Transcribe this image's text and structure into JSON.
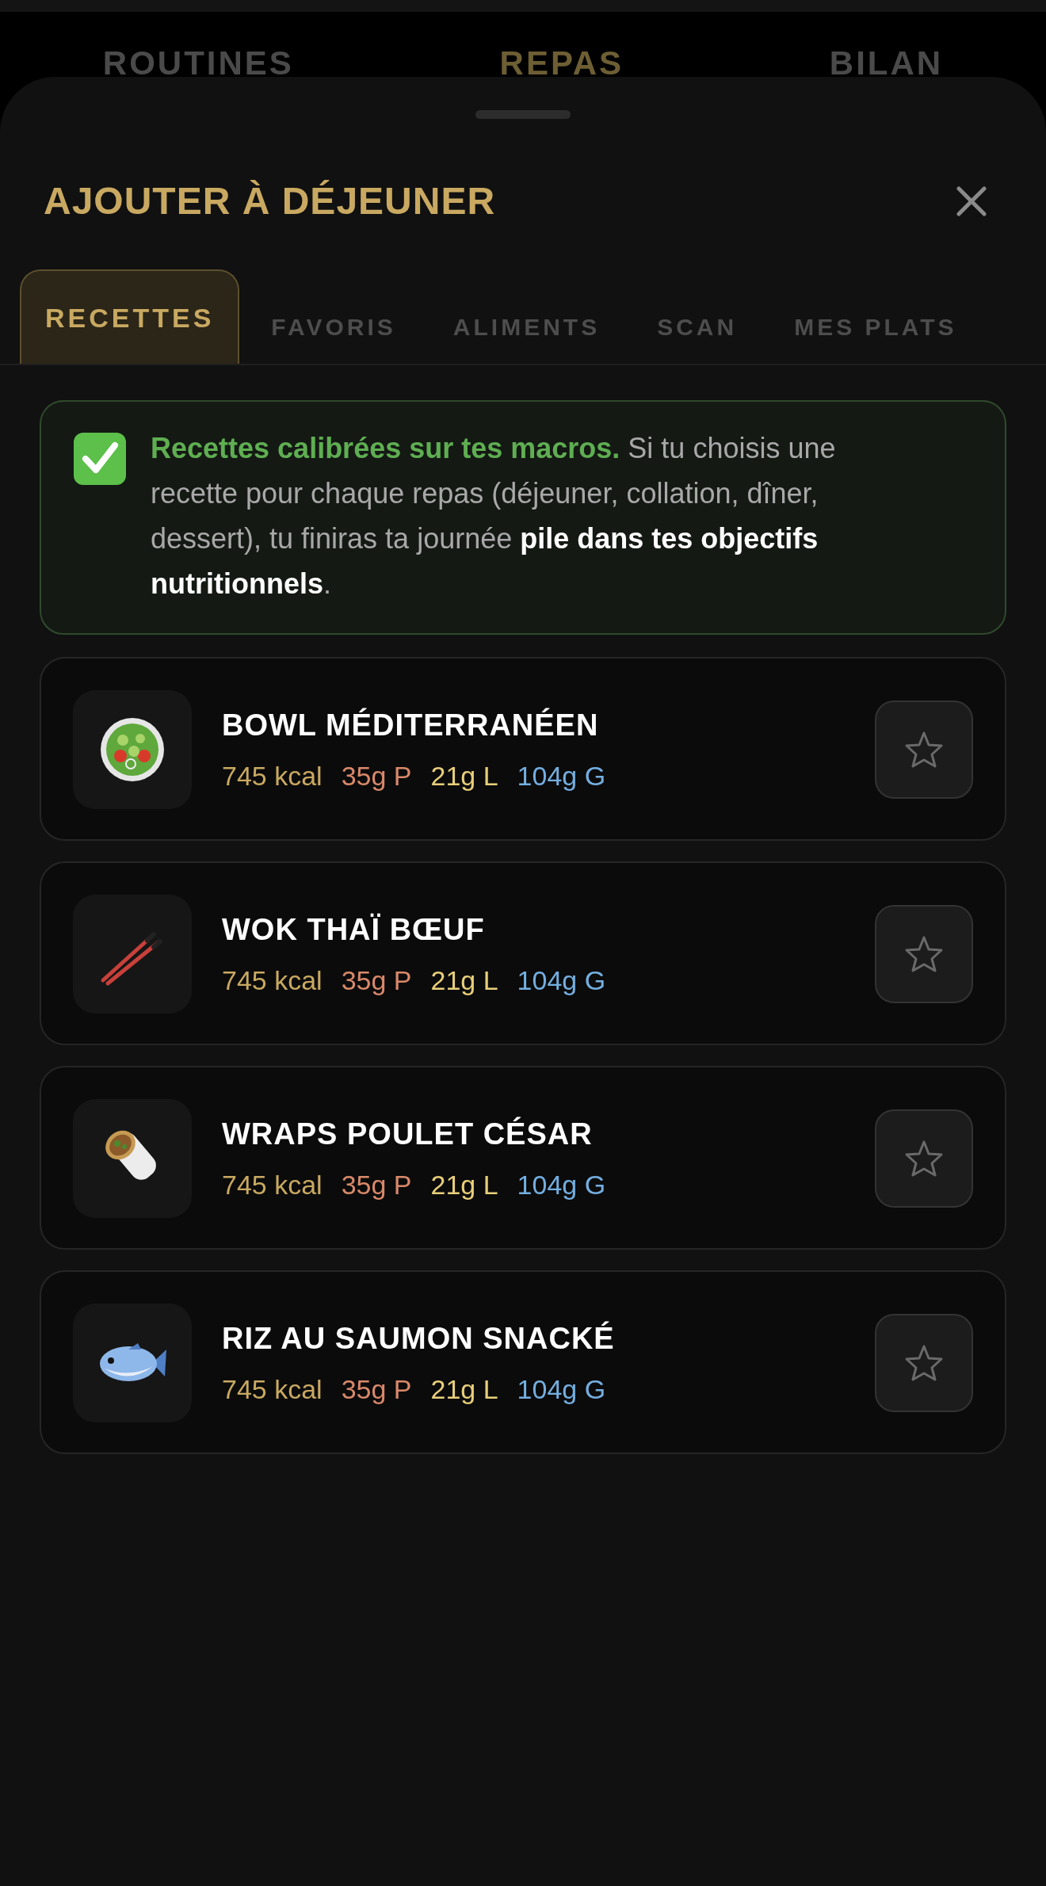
{
  "background_nav": [
    {
      "label": "ROUTINES",
      "selected": false
    },
    {
      "label": "REPAS",
      "selected": true
    },
    {
      "label": "BILAN",
      "selected": false
    }
  ],
  "sheet": {
    "title": "AJOUTER À DÉJEUNER",
    "tabs": [
      {
        "label": "RECETTES",
        "selected": true
      },
      {
        "label": "FAVORIS",
        "selected": false
      },
      {
        "label": "ALIMENTS",
        "selected": false
      },
      {
        "label": "SCAN",
        "selected": false
      },
      {
        "label": "MES PLATS",
        "selected": false
      }
    ],
    "banner": {
      "text": "**Recettes calibrées sur tes macros.** Si tu choisis une recette pour chaque repas (déjeuner, collation, dîner, dessert), tu finiras ta journée **pile dans tes objectifs nutritionnels**."
    },
    "recipes": [
      {
        "name": "BOWL MÉDITERRANÉEN",
        "favorite": false,
        "macros": [
          {
            "kind": "kcal",
            "text": "745 kcal"
          },
          {
            "kind": "protein",
            "text": "35g P"
          },
          {
            "kind": "fat",
            "text": "21g L"
          },
          {
            "kind": "carbs",
            "text": "104g G"
          }
        ]
      },
      {
        "name": "WOK THAÏ BŒUF",
        "favorite": false,
        "macros": [
          {
            "kind": "kcal",
            "text": "745 kcal"
          },
          {
            "kind": "protein",
            "text": "35g P"
          },
          {
            "kind": "fat",
            "text": "21g L"
          },
          {
            "kind": "carbs",
            "text": "104g G"
          }
        ]
      },
      {
        "name": "WRAPS POULET CÉSAR",
        "favorite": false,
        "macros": [
          {
            "kind": "kcal",
            "text": "745 kcal"
          },
          {
            "kind": "protein",
            "text": "35g P"
          },
          {
            "kind": "fat",
            "text": "21g L"
          },
          {
            "kind": "carbs",
            "text": "104g G"
          }
        ]
      },
      {
        "name": "RIZ AU SAUMON SNACKÉ",
        "favorite": false,
        "macros": [
          {
            "kind": "kcal",
            "text": "745 kcal"
          },
          {
            "kind": "protein",
            "text": "35g P"
          },
          {
            "kind": "fat",
            "text": "21g L"
          },
          {
            "kind": "carbs",
            "text": "104g G"
          }
        ]
      }
    ]
  }
}
